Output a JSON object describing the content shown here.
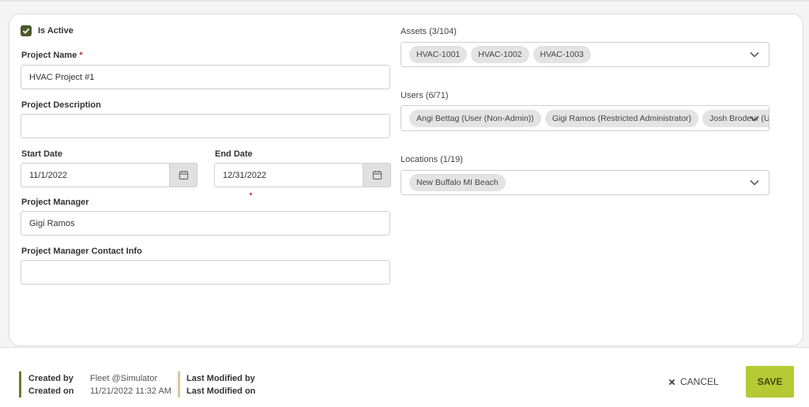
{
  "form": {
    "is_active_label": "Is Active",
    "is_active": true,
    "project_name": {
      "label": "Project Name",
      "required": "*",
      "value": "HVAC Project #1"
    },
    "project_description": {
      "label": "Project Description",
      "value": ""
    },
    "start_date": {
      "label": "Start Date",
      "value": "11/1/2022"
    },
    "end_date": {
      "label": "End Date",
      "value": "12/31/2022"
    },
    "project_manager": {
      "label": "Project Manager",
      "value": "Gigi Ramos"
    },
    "project_manager_contact": {
      "label": "Project Manager Contact Info",
      "value": ""
    }
  },
  "assets": {
    "label": "Assets (3/104)",
    "chips": [
      "HVAC-1001",
      "HVAC-1002",
      "HVAC-1003"
    ]
  },
  "users": {
    "label": "Users (6/71)",
    "chips": [
      "Angi Bettag (User (Non-Admin))",
      "Gigi Ramos (Restricted Administrator)",
      "Josh Brodeur (User"
    ]
  },
  "locations": {
    "label": "Locations (1/19)",
    "chips": [
      "New Buffalo MI Beach"
    ]
  },
  "footer": {
    "created_by_label": "Created by",
    "created_by": "Fleet @Simulator",
    "created_on_label": "Created on",
    "created_on": "11/21/2022 11:32 AM",
    "last_modified_by_label": "Last Modified by",
    "last_modified_on_label": "Last Modified on",
    "cancel_label": "CANCEL",
    "save_label": "SAVE"
  },
  "colors": {
    "accent": "#b5c934",
    "checkbox": "#4b5a2a",
    "footer_bar_left": "#6b7a2e",
    "footer_bar_right": "#d8c8a0"
  },
  "icons": [
    "check-icon",
    "calendar-icon",
    "chevron-down-icon",
    "close-icon"
  ]
}
